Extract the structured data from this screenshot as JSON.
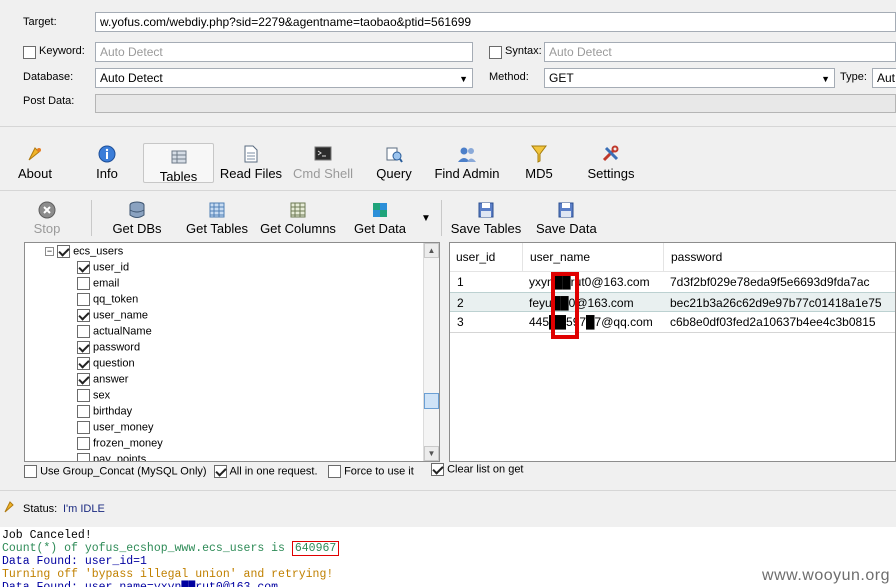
{
  "form": {
    "target_label": "Target:",
    "target_value": "w.yofus.com/webdiy.php?sid=2279&agentname=taobao&ptid=561699",
    "keyword_label": "Keyword:",
    "keyword_placeholder": "Auto Detect",
    "syntax_label": "Syntax:",
    "syntax_placeholder": "Auto Detect",
    "database_label": "Database:",
    "database_value": "Auto Detect",
    "method_label": "Method:",
    "method_value": "GET",
    "type_label": "Type:",
    "type_value": "Aut",
    "postdata_label": "Post Data:"
  },
  "toolbar": {
    "items": [
      {
        "label": "About",
        "icon": "about-icon"
      },
      {
        "label": "Info",
        "icon": "info-icon"
      },
      {
        "label": "Tables",
        "icon": "tables-icon"
      },
      {
        "label": "Read Files",
        "icon": "read-files-icon"
      },
      {
        "label": "Cmd Shell",
        "icon": "cmd-shell-icon"
      },
      {
        "label": "Query",
        "icon": "query-icon"
      },
      {
        "label": "Find Admin",
        "icon": "find-admin-icon"
      },
      {
        "label": "MD5",
        "icon": "md5-icon"
      },
      {
        "label": "Settings",
        "icon": "settings-icon"
      }
    ]
  },
  "subtoolbar": {
    "stop": "Stop",
    "get_dbs": "Get DBs",
    "get_tables": "Get Tables",
    "get_columns": "Get Columns",
    "get_data": "Get Data",
    "save_tables": "Save Tables",
    "save_data": "Save Data"
  },
  "tree": {
    "table": "ecs_users",
    "columns": [
      {
        "name": "user_id",
        "checked": true
      },
      {
        "name": "email",
        "checked": false
      },
      {
        "name": "qq_token",
        "checked": false
      },
      {
        "name": "user_name",
        "checked": true
      },
      {
        "name": "actualName",
        "checked": false
      },
      {
        "name": "password",
        "checked": true
      },
      {
        "name": "question",
        "checked": true
      },
      {
        "name": "answer",
        "checked": true
      },
      {
        "name": "sex",
        "checked": false
      },
      {
        "name": "birthday",
        "checked": false
      },
      {
        "name": "user_money",
        "checked": false
      },
      {
        "name": "frozen_money",
        "checked": false
      },
      {
        "name": "pay_points",
        "checked": false
      }
    ]
  },
  "grid": {
    "headers": [
      "user_id",
      "user_name",
      "password"
    ],
    "rows": [
      [
        "1",
        "yxyn██rut0@163.com",
        "7d3f2bf029e78eda9f5e6693d9fda7ac"
      ],
      [
        "2",
        "feyu██0@163.com",
        "bec21b3a26c62d9e97b77c01418a1e75"
      ],
      [
        "3",
        "445██597█7@qq.com",
        "c6b8e0df03fed2a10637b4ee4c3b0815"
      ]
    ]
  },
  "options": {
    "group_concat": "Use Group_Concat (MySQL Only)",
    "all_in_one": "All in one request.",
    "force": "Force to use it",
    "clear_list": "Clear list on get"
  },
  "status": {
    "label": "Status:",
    "value": "I'm IDLE"
  },
  "log": {
    "lines": [
      {
        "text": "Job Canceled!",
        "color": "#000000"
      },
      {
        "text": "Count(*) of yofus_ecshop_www.ecs_users is ",
        "highlight": "640967",
        "color": "#2e8b57"
      },
      {
        "text": "Data Found: user_id=1",
        "color": "#0000a0"
      },
      {
        "text": "Turning off 'bypass illegal union' and retrying!",
        "color": "#c08000"
      },
      {
        "text": "Data Found: user_name=yxyn██rut0@163.com",
        "color": "#0000a0"
      }
    ]
  },
  "watermark": "www.wooyun.org",
  "colors": {
    "redact": "#e00000",
    "accent_blue": "#1e5fb4"
  }
}
